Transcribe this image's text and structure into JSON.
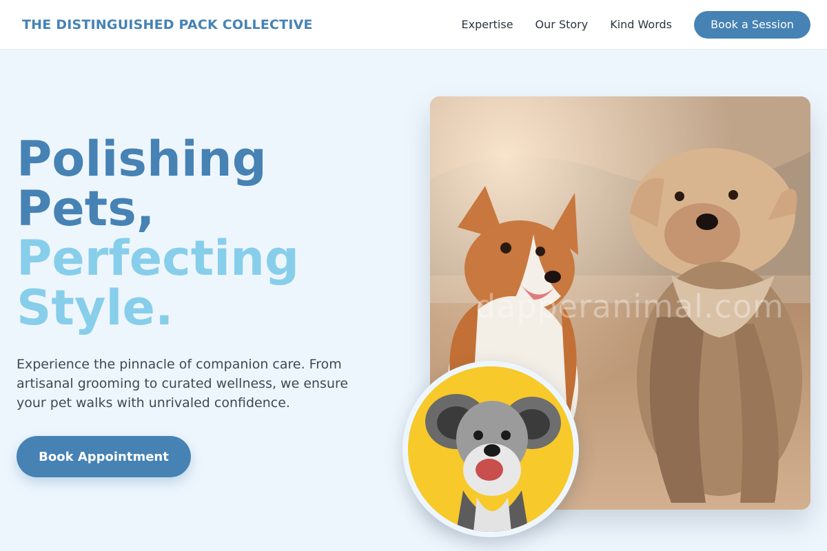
{
  "header": {
    "brand": "THE DISTINGUISHED PACK COLLECTIVE",
    "nav": [
      {
        "label": "Expertise"
      },
      {
        "label": "Our Story"
      },
      {
        "label": "Kind Words"
      }
    ],
    "cta_label": "Book a Session"
  },
  "hero": {
    "headline_lines": [
      "Polishing",
      "Pets,",
      "Perfecting",
      "Style."
    ],
    "subtext": "Experience the pinnacle of companion care. From artisanal grooming to curated wellness, we ensure your pet walks with unrivaled confidence.",
    "cta_label": "Book Appointment"
  },
  "media": {
    "watermark": "dapperanimal.com"
  },
  "colors": {
    "primary": "#4682b4",
    "accent": "#87ceeb",
    "background": "#eef6fd",
    "avatar_bg": "#f7c92a"
  }
}
